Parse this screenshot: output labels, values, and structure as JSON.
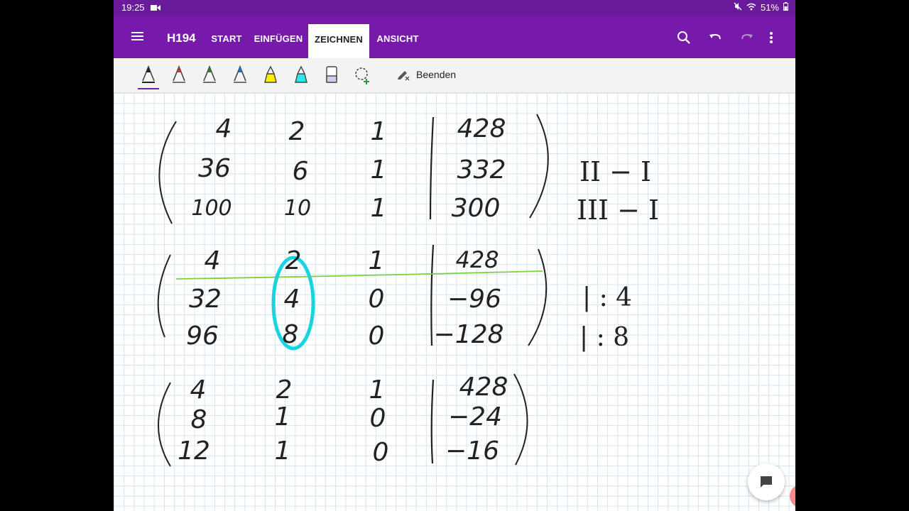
{
  "status_bar": {
    "time": "19:25",
    "battery": "51%"
  },
  "app_bar": {
    "title": "H194",
    "tabs": [
      {
        "label": "START"
      },
      {
        "label": "EINFÜGEN"
      },
      {
        "label": "ZEICHNEN",
        "active": true
      },
      {
        "label": "ANSICHT"
      }
    ]
  },
  "toolbar": {
    "finish_label": "Beenden",
    "tools": [
      {
        "icon": "pen-black-icon",
        "color": "#222222",
        "active": true
      },
      {
        "icon": "pen-red-icon",
        "color": "#d32f2f"
      },
      {
        "icon": "pen-green-icon",
        "color": "#2e7d32"
      },
      {
        "icon": "pen-blue-icon",
        "color": "#1976d2"
      },
      {
        "icon": "highlighter-yellow-icon",
        "color": "#ffee00"
      },
      {
        "icon": "highlighter-cyan-icon",
        "color": "#2ee6f0"
      },
      {
        "icon": "eraser-icon",
        "color": "#8e6bbf"
      },
      {
        "icon": "lasso-add-icon",
        "color": "#2e9d3b"
      }
    ]
  },
  "ink": {
    "matrix1": {
      "rows": [
        [
          "4",
          "2",
          "1",
          "428"
        ],
        [
          "36",
          "6",
          "1",
          "332"
        ],
        [
          "100",
          "10",
          "1",
          "300"
        ]
      ],
      "notes": [
        "II − I",
        "III − I"
      ]
    },
    "matrix2": {
      "rows": [
        [
          "4",
          "2",
          "1",
          "428"
        ],
        [
          "32",
          "4",
          "0",
          "−96"
        ],
        [
          "96",
          "8",
          "0",
          "−128"
        ]
      ],
      "notes": [
        "| : 4",
        "| : 8"
      ]
    },
    "matrix3": {
      "rows": [
        [
          "4",
          "2",
          "1",
          "428"
        ],
        [
          "8",
          "1",
          "0",
          "−24"
        ],
        [
          "12",
          "1",
          "0",
          "−16"
        ]
      ]
    }
  },
  "colors": {
    "accent": "#7719aa",
    "statusbar": "#6a1b9a",
    "green_ink": "#7bd13a",
    "cyan_ink": "#19d3e0"
  }
}
